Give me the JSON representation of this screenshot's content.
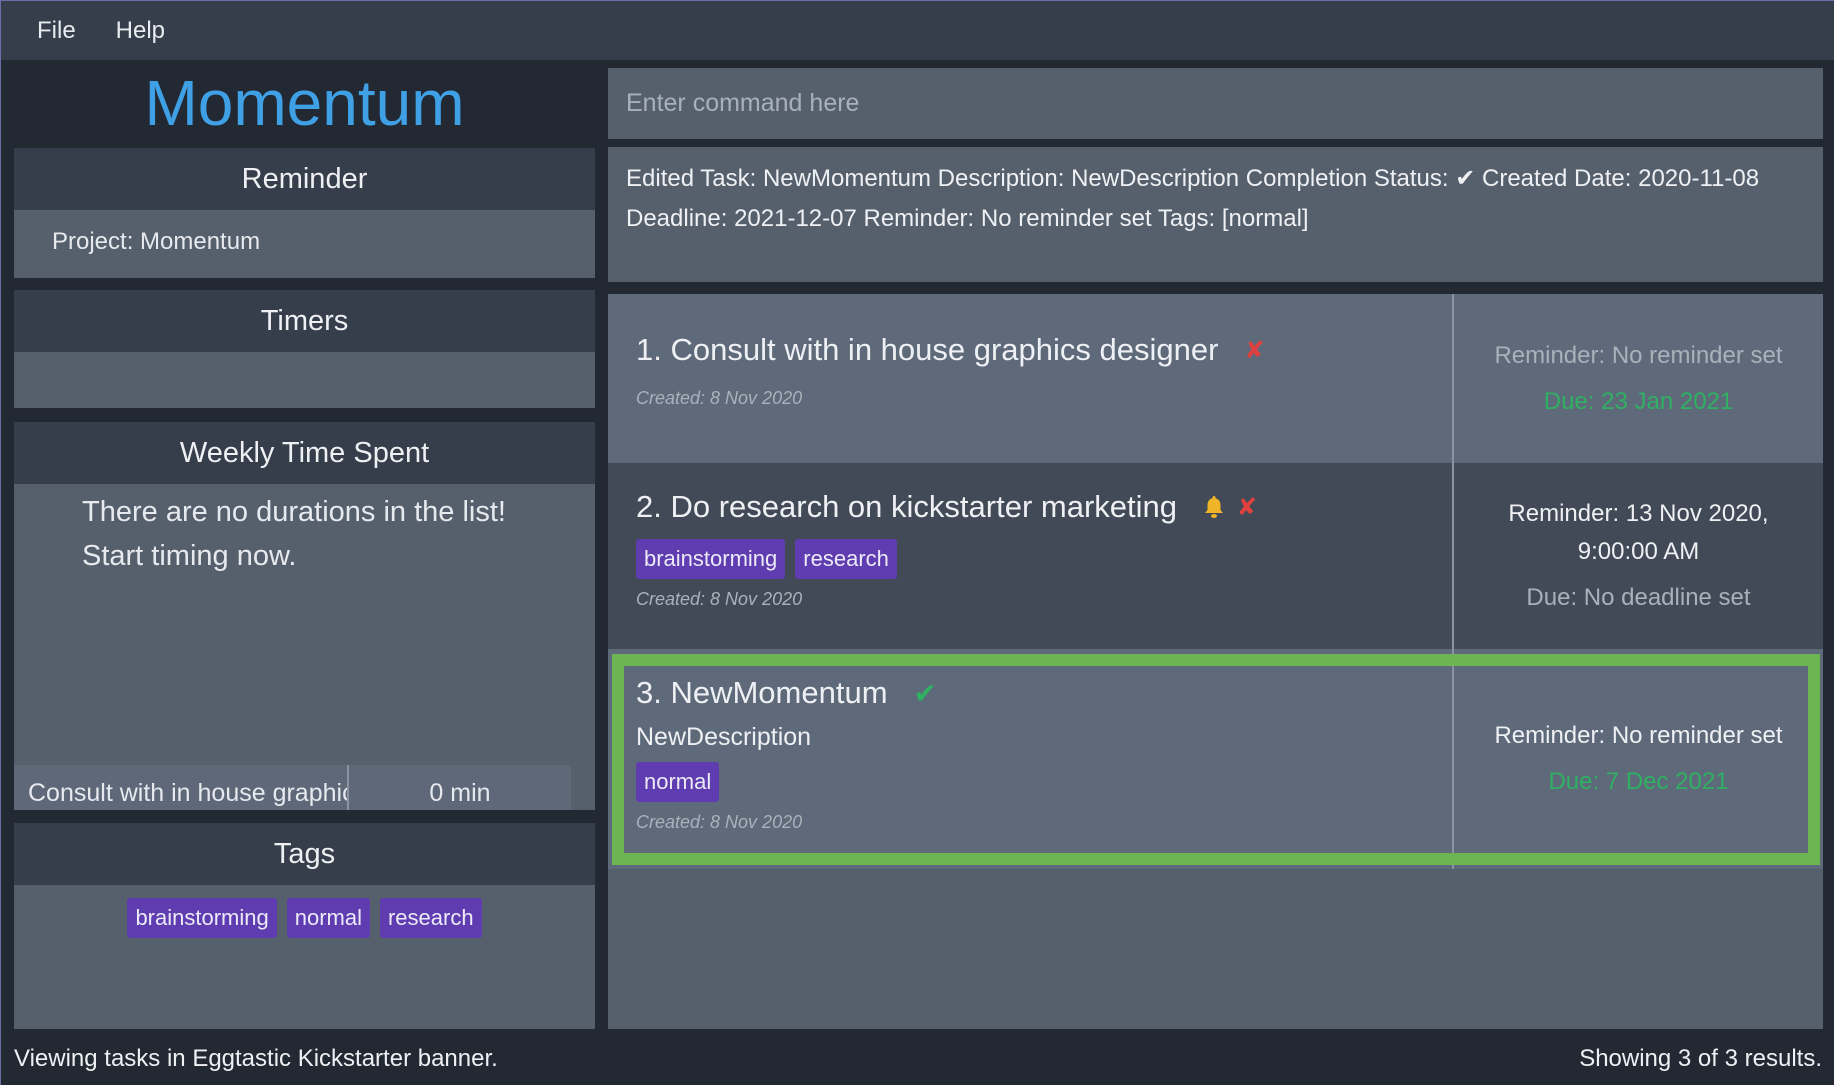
{
  "menu": {
    "file": "File",
    "help": "Help"
  },
  "app": {
    "title": "Momentum"
  },
  "sidebar": {
    "reminder": {
      "header": "Reminder",
      "content": "Project: Momentum"
    },
    "timers": {
      "header": "Timers"
    },
    "weekly": {
      "header": "Weekly Time Spent",
      "empty_line1": "There are no durations in the list!",
      "empty_line2": "Start timing now.",
      "durations": [
        {
          "name": "Consult with in house graphic...",
          "value": "0 min"
        }
      ]
    },
    "tags": {
      "header": "Tags",
      "items": [
        "brainstorming",
        "normal",
        "research"
      ]
    }
  },
  "command": {
    "placeholder": "Enter command here",
    "value": ""
  },
  "result": {
    "line1": "Edited Task: NewMomentum Description: NewDescription Completion Status: ✔ Created Date: 2020-11-08",
    "line2": "Deadline: 2021-12-07 Reminder: No reminder set Tags: [normal]"
  },
  "tasks": [
    {
      "title": "1. Consult with in house graphics designer",
      "completed": false,
      "has_reminder": false,
      "created": "Created: 8 Nov 2020",
      "reminder": "Reminder: No reminder set",
      "due": "Due: 23 Jan 2021",
      "tags": []
    },
    {
      "title": "2. Do research on kickstarter marketing",
      "completed": false,
      "has_reminder": true,
      "tags": [
        "brainstorming",
        "research"
      ],
      "created": "Created: 8 Nov 2020",
      "reminder_line1": "Reminder: 13 Nov 2020,",
      "reminder_line2": "9:00:00 AM",
      "due": "Due: No deadline set"
    },
    {
      "title": "3. NewMomentum",
      "completed": true,
      "selected": true,
      "description": "NewDescription",
      "tags": [
        "normal"
      ],
      "created": "Created: 8 Nov 2020",
      "reminder": "Reminder: No reminder set",
      "due": "Due: 7 Dec 2021"
    }
  ],
  "icons": {
    "cross": "✘",
    "check": "✔"
  },
  "colors": {
    "accent": "#3fa0e6",
    "tag": "#5f3db1",
    "selected": "#6db552",
    "due": "#2fb062",
    "cross": "#e0403e",
    "bell": "#f0b429"
  },
  "status": {
    "left": "Viewing tasks in Eggtastic Kickstarter banner.",
    "right": "Showing 3 of 3 results."
  }
}
